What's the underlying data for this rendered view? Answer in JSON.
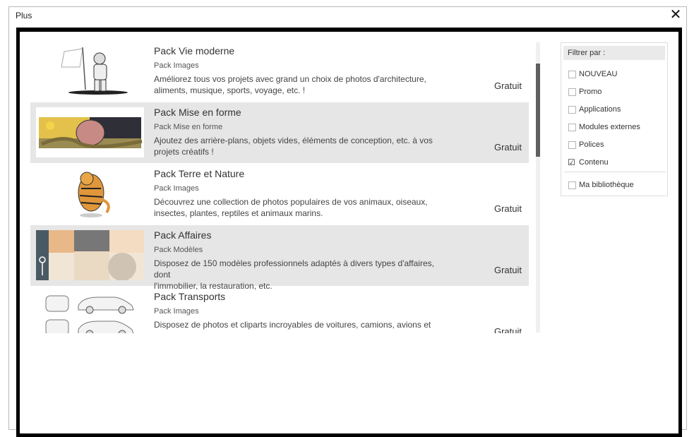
{
  "window": {
    "title": "Plus"
  },
  "items": [
    {
      "title": "Pack Vie moderne",
      "subtitle": "Pack Images",
      "desc1": "Améliorez tous vos projets avec grand un choix de photos d'architecture,",
      "desc2": "aliments, musique, sports, voyage, etc. !",
      "price": "Gratuit",
      "thumb": "astronaut-flag-image"
    },
    {
      "title": "Pack Mise en forme",
      "subtitle": "Pack Mise en forme",
      "desc1": "Ajoutez des arrière-plans, objets vides, éléments de conception, etc. à vos",
      "desc2": "projets créatifs !",
      "price": "Gratuit",
      "thumb": "snake-desert-banner-image"
    },
    {
      "title": "Pack Terre et Nature",
      "subtitle": "Pack Images",
      "desc1": "Découvrez une collection de photos populaires de vos animaux, oiseaux,",
      "desc2": "insectes, plantes, reptiles et animaux marins.",
      "price": "Gratuit",
      "thumb": "tiger-image"
    },
    {
      "title": "Pack Affaires",
      "subtitle": "Pack Modèles",
      "desc1": "Disposez de 150 modèles professionnels adaptés à divers types d'affaires, dont",
      "desc2": "l'immobilier, la restauration, etc.",
      "price": "Gratuit",
      "thumb": "business-template-image"
    },
    {
      "title": "Pack Transports",
      "subtitle": "Pack Images",
      "desc1": "Disposez de photos et cliparts incroyables de voitures, camions, avions et",
      "desc2": "",
      "price": "Gratuit",
      "thumb": "cars-image"
    }
  ],
  "filter": {
    "header": "Filtrer par :",
    "options": [
      {
        "label": "NOUVEAU",
        "checked": false
      },
      {
        "label": "Promo",
        "checked": false
      },
      {
        "label": "Applications",
        "checked": false
      },
      {
        "label": "Modules externes",
        "checked": false
      },
      {
        "label": "Polices",
        "checked": false
      },
      {
        "label": "Contenu",
        "checked": true
      }
    ],
    "library": {
      "label": "Ma bibliothèque",
      "checked": false
    },
    "check_mark": "☑"
  },
  "colors": {
    "shaded_row": "#e6e6e6",
    "scroll_thumb": "#5f5f5f",
    "frame": "#000000"
  }
}
